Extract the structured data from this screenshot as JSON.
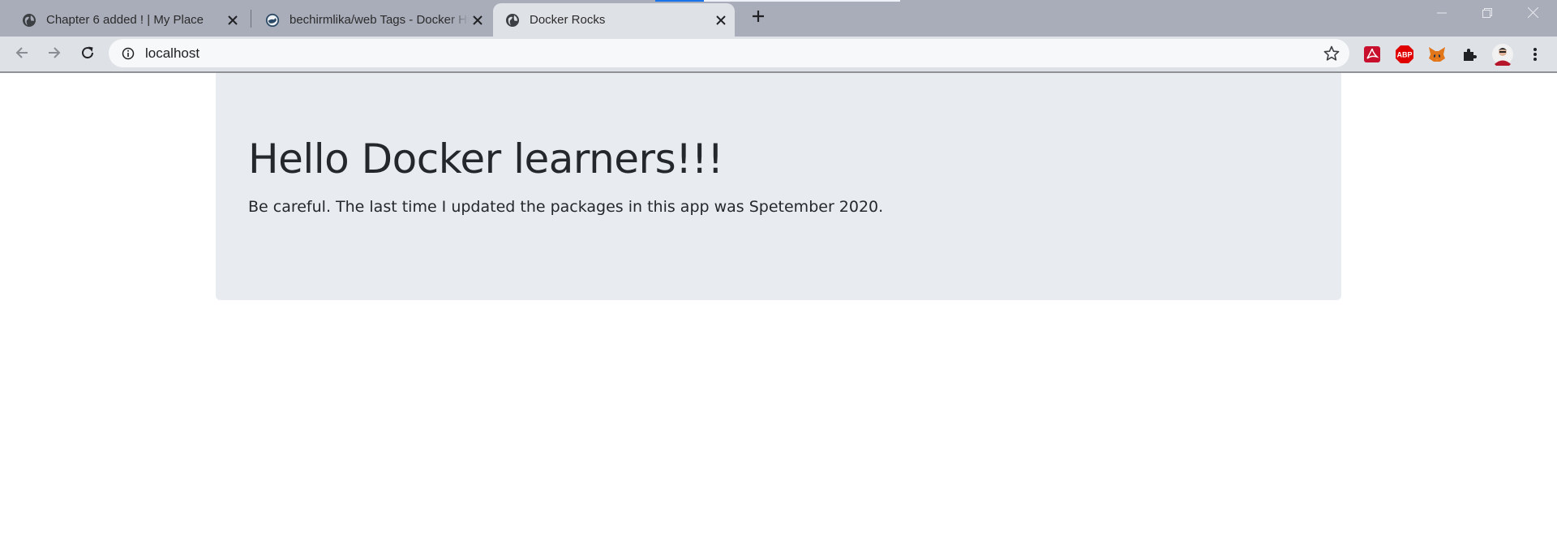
{
  "browser": {
    "tabs": [
      {
        "title": "Chapter 6 added ! | My Place",
        "active": false,
        "favicon": "globe-icon"
      },
      {
        "title": "bechirmlika/web Tags - Docker Hub",
        "active": false,
        "favicon": "docker-hub-icon"
      },
      {
        "title": "Docker Rocks",
        "active": true,
        "favicon": "globe-icon"
      }
    ],
    "address_bar": {
      "url": "localhost"
    },
    "extensions": [
      "acrobat-extension-icon",
      "adblock-plus-extension-icon",
      "metamask-extension-icon",
      "puzzle-extensions-icon"
    ],
    "colors": {
      "tab_strip": "#a9adba",
      "toolbar": "#dee1e6",
      "loading_indicator": "#1a73e8"
    }
  },
  "page": {
    "heading": "Hello Docker learners!!!",
    "lead": "Be careful. The last time I updated the packages in this app was Spetember 2020.",
    "colors": {
      "jumbotron_bg": "#e8ebef",
      "text": "#24282d"
    }
  }
}
